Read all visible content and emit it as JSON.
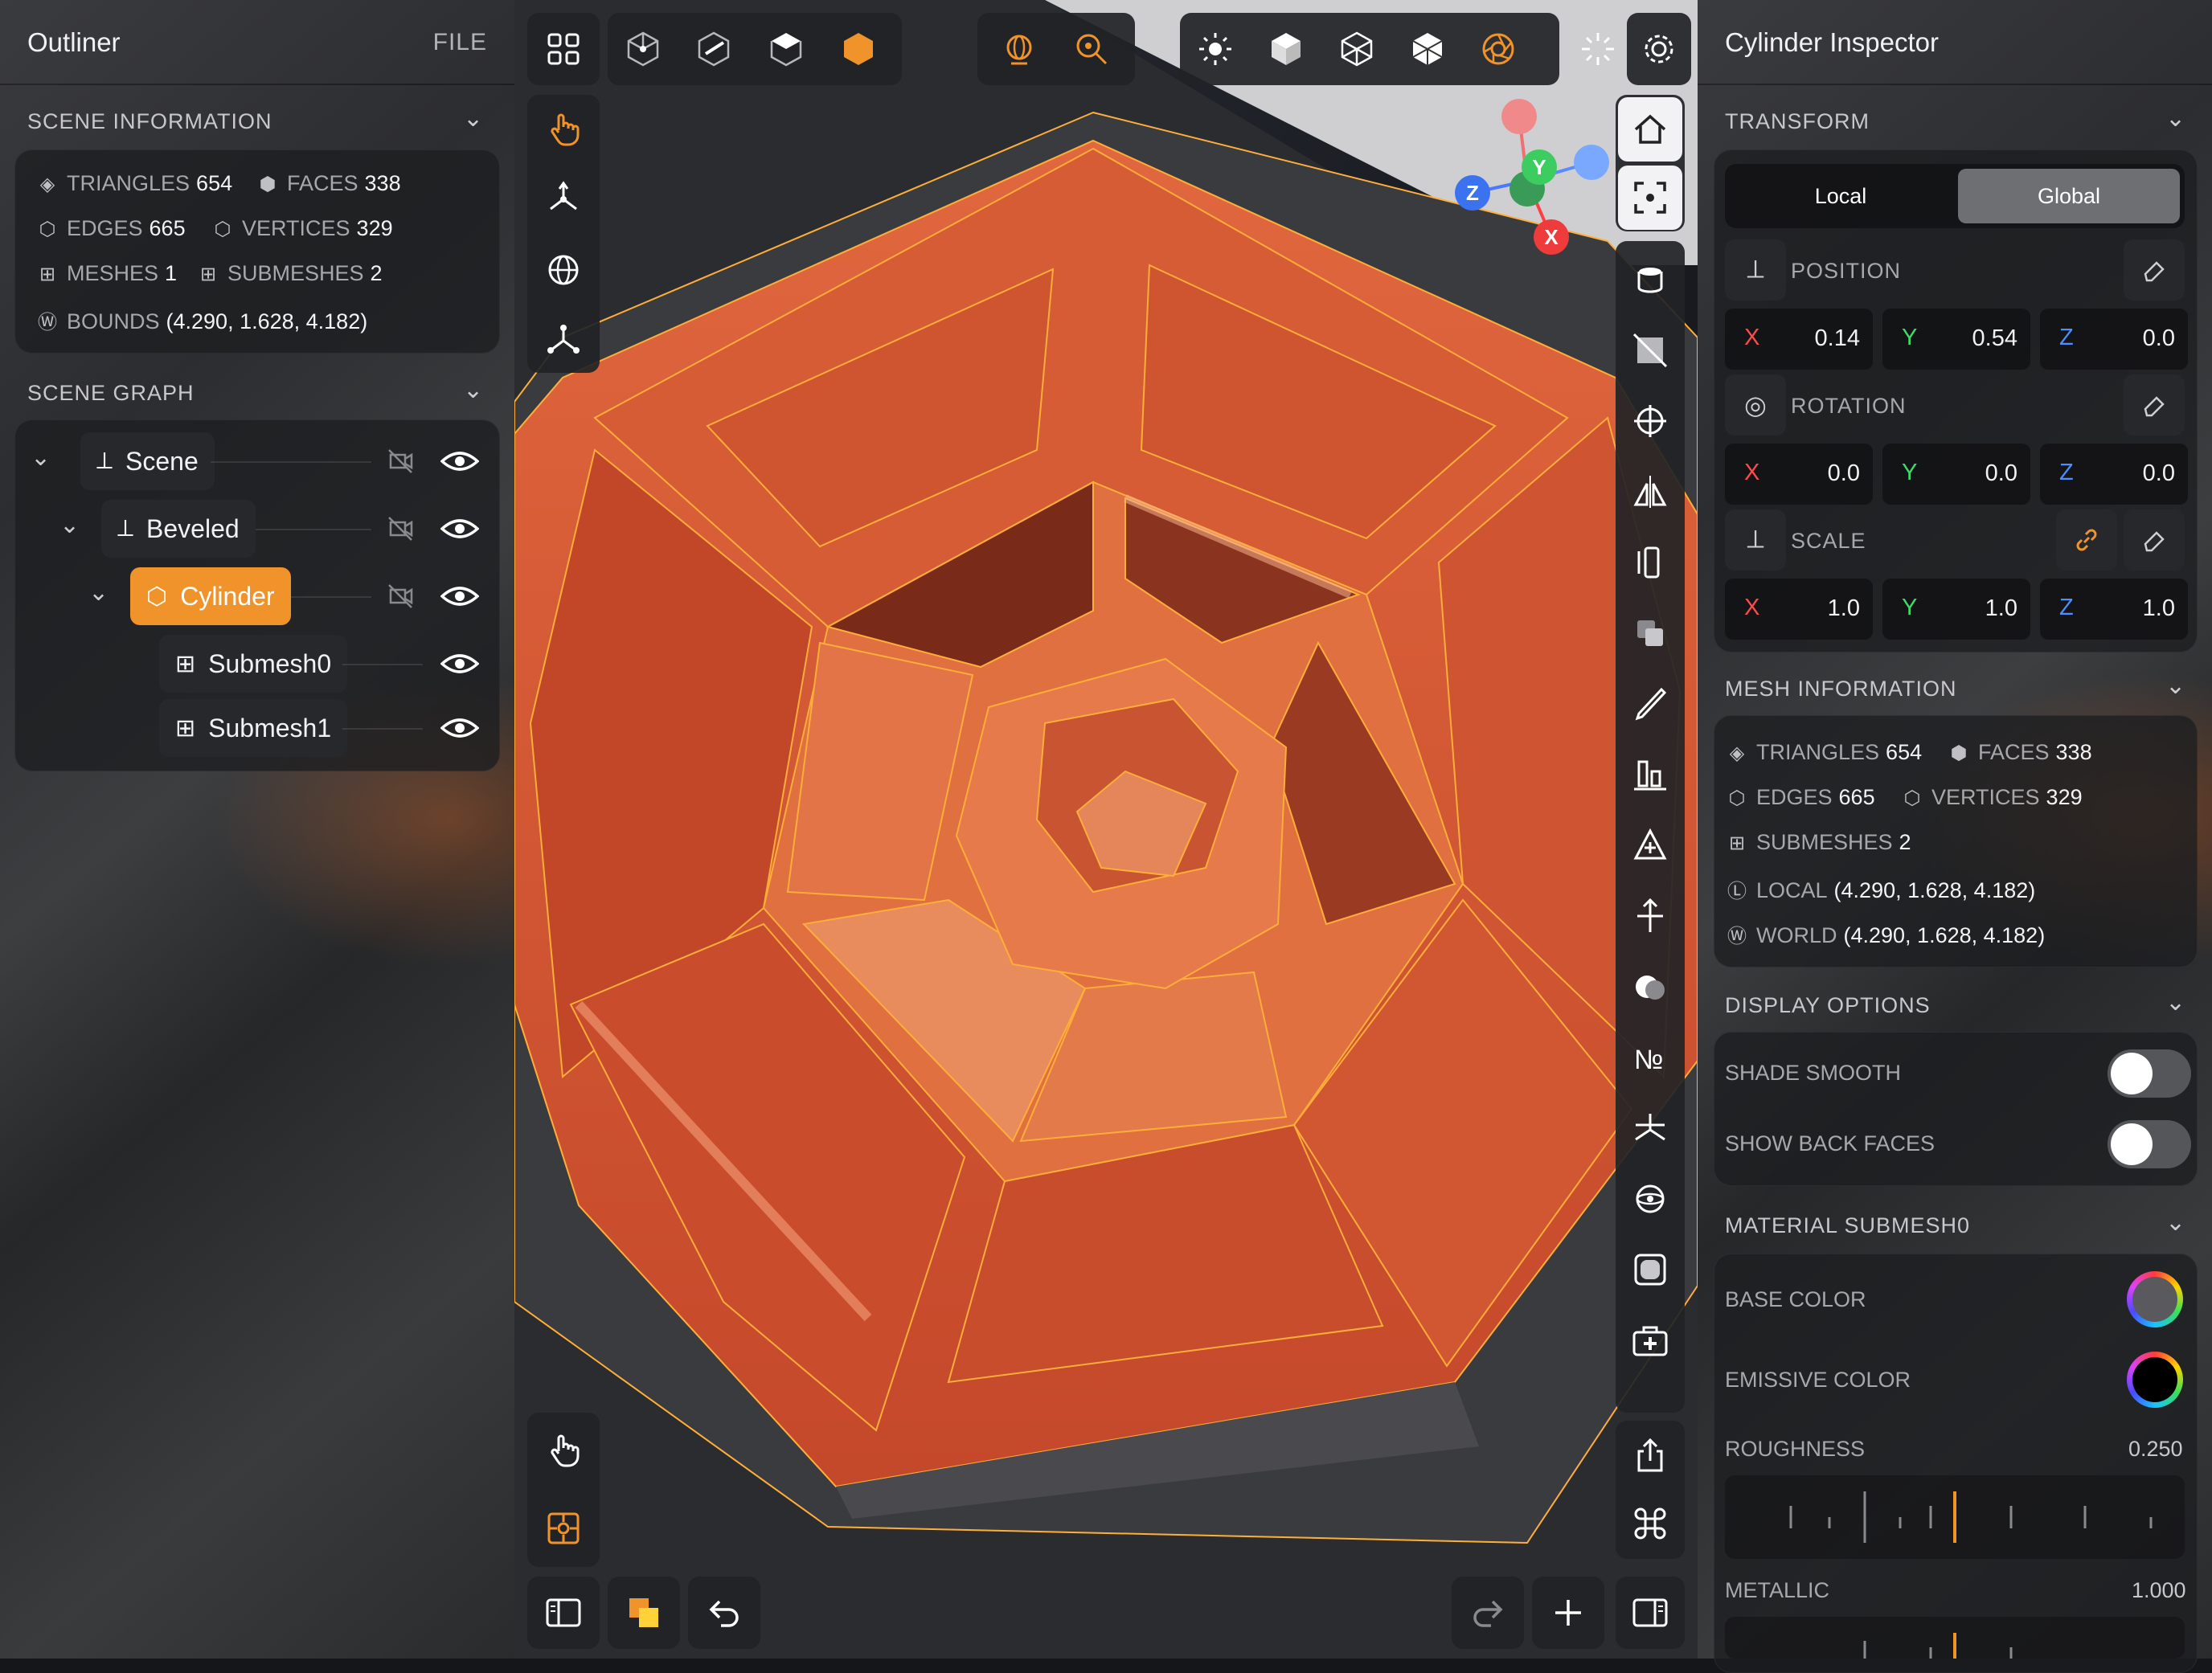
{
  "outliner": {
    "title": "Outliner",
    "file_label": "FILE",
    "scene_info": {
      "heading": "SCENE INFORMATION",
      "triangles_label": "TRIANGLES",
      "triangles": "654",
      "faces_label": "FACES",
      "faces": "338",
      "edges_label": "EDGES",
      "edges": "665",
      "vertices_label": "VERTICES",
      "vertices": "329",
      "meshes_label": "MESHES",
      "meshes": "1",
      "submeshes_label": "SUBMESHES",
      "submeshes": "2",
      "bounds_label": "BOUNDS",
      "bounds": "(4.290, 1.628, 4.182)"
    },
    "scene_graph": {
      "heading": "SCENE GRAPH",
      "nodes": [
        {
          "label": "Scene",
          "icon": "axes-icon"
        },
        {
          "label": "Beveled",
          "icon": "axes-icon"
        },
        {
          "label": "Cylinder",
          "icon": "cube-icon",
          "selected": true
        },
        {
          "label": "Submesh0",
          "icon": "grid-icon"
        },
        {
          "label": "Submesh1",
          "icon": "grid-icon"
        }
      ]
    }
  },
  "inspector": {
    "title": "Cylinder Inspector",
    "transform": {
      "heading": "TRANSFORM",
      "local_label": "Local",
      "global_label": "Global",
      "active_space": "Global",
      "position_label": "POSITION",
      "position": {
        "x": "0.14",
        "y": "0.54",
        "z": "0.0"
      },
      "rotation_label": "ROTATION",
      "rotation": {
        "x": "0.0",
        "y": "0.0",
        "z": "0.0"
      },
      "scale_label": "SCALE",
      "scale": {
        "x": "1.0",
        "y": "1.0",
        "z": "1.0"
      },
      "axis_x": "X",
      "axis_y": "Y",
      "axis_z": "Z"
    },
    "mesh_info": {
      "heading": "MESH INFORMATION",
      "triangles_label": "TRIANGLES",
      "triangles": "654",
      "faces_label": "FACES",
      "faces": "338",
      "edges_label": "EDGES",
      "edges": "665",
      "vertices_label": "VERTICES",
      "vertices": "329",
      "submeshes_label": "SUBMESHES",
      "submeshes": "2",
      "local_label": "LOCAL",
      "local": "(4.290, 1.628, 4.182)",
      "world_label": "WORLD",
      "world": "(4.290, 1.628, 4.182)"
    },
    "display": {
      "heading": "DISPLAY OPTIONS",
      "shade_smooth_label": "SHADE SMOOTH",
      "shade_smooth": false,
      "show_back_faces_label": "SHOW BACK FACES",
      "show_back_faces": false
    },
    "material": {
      "heading": "MATERIAL  SUBMESH0",
      "base_color_label": "BASE COLOR",
      "base_color": "#5a5a5e",
      "emissive_color_label": "EMISSIVE COLOR",
      "emissive_color": "#000000",
      "roughness_label": "ROUGHNESS",
      "roughness": "0.250",
      "metallic_label": "METALLIC",
      "metallic": "1.000"
    }
  },
  "viewport": {
    "gizmo": {
      "x": "X",
      "y": "Y",
      "z": "Z"
    },
    "colors": {
      "accent": "#f0932a",
      "mesh": "#d4532f",
      "wire": "#ffae3a"
    }
  }
}
